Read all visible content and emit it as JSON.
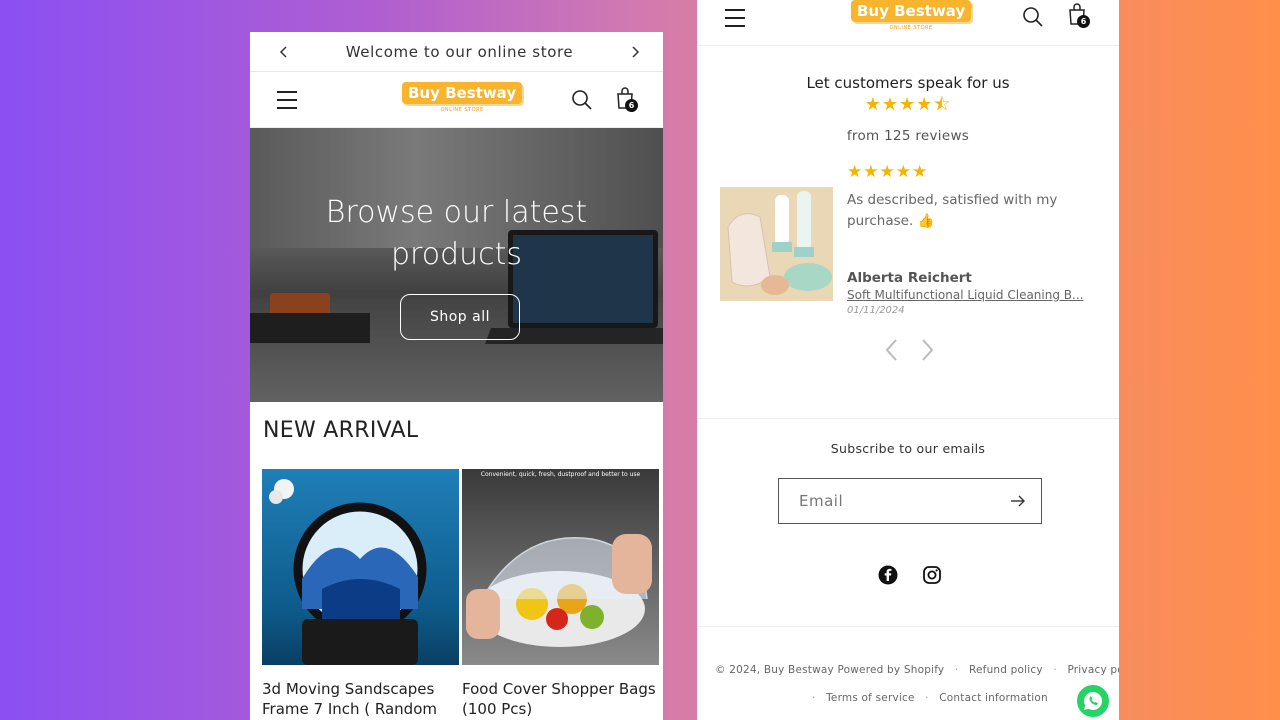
{
  "left": {
    "announcement": "Welcome to our online store",
    "logo": {
      "text": "Buy Bestway",
      "sub": "ONLINE STORE"
    },
    "cart_count": "6",
    "hero": {
      "title_line1": "Browse our latest",
      "title_line2": "products",
      "button": "Shop all"
    },
    "section_title": "NEW ARRIVAL",
    "products": [
      {
        "title_line1": "3d Moving Sandscapes",
        "title_line2": "Frame 7 Inch ( Random"
      },
      {
        "title_line1": "Food Cover Shopper Bags",
        "title_line2": "(100 Pcs)",
        "image_caption": "Convenient, quick, fresh, dustproof and better to use"
      }
    ]
  },
  "right": {
    "logo": {
      "text": "Buy Bestway",
      "sub": "ONLINE STORE"
    },
    "cart_count": "6",
    "reviews": {
      "heading": "Let customers speak for us",
      "stars": "★★★★⯪",
      "count": "from 125 reviews",
      "item": {
        "stars": "★★★★★",
        "body": "As described, satisfied with my purchase. 👍",
        "author": "Alberta Reichert",
        "product": "Soft Multifunctional Liquid Cleaning B...",
        "date": "01/11/2024"
      }
    },
    "subscribe": {
      "title": "Subscribe to our emails",
      "placeholder": "Email"
    },
    "footer": {
      "copyright": "© 2024, Buy Bestway",
      "powered": "Powered by Shopify",
      "links1": [
        "Refund policy",
        "Privacy policy"
      ],
      "links2": [
        "Terms of service",
        "Contact information"
      ]
    }
  },
  "colors": {
    "brand": "#f7b42c",
    "star": "#f4b400",
    "whatsapp": "#25d366"
  }
}
